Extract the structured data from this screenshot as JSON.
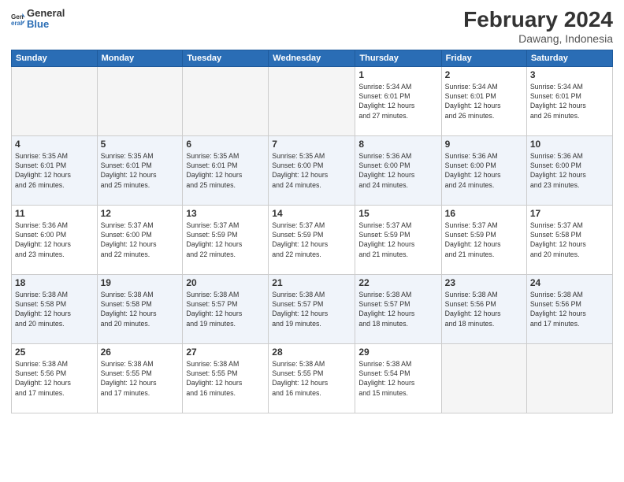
{
  "logo": {
    "line1": "General",
    "line2": "Blue"
  },
  "title": "February 2024",
  "subtitle": "Dawang, Indonesia",
  "days_header": [
    "Sunday",
    "Monday",
    "Tuesday",
    "Wednesday",
    "Thursday",
    "Friday",
    "Saturday"
  ],
  "weeks": [
    {
      "alt": false,
      "days": [
        {
          "num": "",
          "info": ""
        },
        {
          "num": "",
          "info": ""
        },
        {
          "num": "",
          "info": ""
        },
        {
          "num": "",
          "info": ""
        },
        {
          "num": "1",
          "info": "Sunrise: 5:34 AM\nSunset: 6:01 PM\nDaylight: 12 hours\nand 27 minutes."
        },
        {
          "num": "2",
          "info": "Sunrise: 5:34 AM\nSunset: 6:01 PM\nDaylight: 12 hours\nand 26 minutes."
        },
        {
          "num": "3",
          "info": "Sunrise: 5:34 AM\nSunset: 6:01 PM\nDaylight: 12 hours\nand 26 minutes."
        }
      ]
    },
    {
      "alt": true,
      "days": [
        {
          "num": "4",
          "info": "Sunrise: 5:35 AM\nSunset: 6:01 PM\nDaylight: 12 hours\nand 26 minutes."
        },
        {
          "num": "5",
          "info": "Sunrise: 5:35 AM\nSunset: 6:01 PM\nDaylight: 12 hours\nand 25 minutes."
        },
        {
          "num": "6",
          "info": "Sunrise: 5:35 AM\nSunset: 6:01 PM\nDaylight: 12 hours\nand 25 minutes."
        },
        {
          "num": "7",
          "info": "Sunrise: 5:35 AM\nSunset: 6:00 PM\nDaylight: 12 hours\nand 24 minutes."
        },
        {
          "num": "8",
          "info": "Sunrise: 5:36 AM\nSunset: 6:00 PM\nDaylight: 12 hours\nand 24 minutes."
        },
        {
          "num": "9",
          "info": "Sunrise: 5:36 AM\nSunset: 6:00 PM\nDaylight: 12 hours\nand 24 minutes."
        },
        {
          "num": "10",
          "info": "Sunrise: 5:36 AM\nSunset: 6:00 PM\nDaylight: 12 hours\nand 23 minutes."
        }
      ]
    },
    {
      "alt": false,
      "days": [
        {
          "num": "11",
          "info": "Sunrise: 5:36 AM\nSunset: 6:00 PM\nDaylight: 12 hours\nand 23 minutes."
        },
        {
          "num": "12",
          "info": "Sunrise: 5:37 AM\nSunset: 6:00 PM\nDaylight: 12 hours\nand 22 minutes."
        },
        {
          "num": "13",
          "info": "Sunrise: 5:37 AM\nSunset: 5:59 PM\nDaylight: 12 hours\nand 22 minutes."
        },
        {
          "num": "14",
          "info": "Sunrise: 5:37 AM\nSunset: 5:59 PM\nDaylight: 12 hours\nand 22 minutes."
        },
        {
          "num": "15",
          "info": "Sunrise: 5:37 AM\nSunset: 5:59 PM\nDaylight: 12 hours\nand 21 minutes."
        },
        {
          "num": "16",
          "info": "Sunrise: 5:37 AM\nSunset: 5:59 PM\nDaylight: 12 hours\nand 21 minutes."
        },
        {
          "num": "17",
          "info": "Sunrise: 5:37 AM\nSunset: 5:58 PM\nDaylight: 12 hours\nand 20 minutes."
        }
      ]
    },
    {
      "alt": true,
      "days": [
        {
          "num": "18",
          "info": "Sunrise: 5:38 AM\nSunset: 5:58 PM\nDaylight: 12 hours\nand 20 minutes."
        },
        {
          "num": "19",
          "info": "Sunrise: 5:38 AM\nSunset: 5:58 PM\nDaylight: 12 hours\nand 20 minutes."
        },
        {
          "num": "20",
          "info": "Sunrise: 5:38 AM\nSunset: 5:57 PM\nDaylight: 12 hours\nand 19 minutes."
        },
        {
          "num": "21",
          "info": "Sunrise: 5:38 AM\nSunset: 5:57 PM\nDaylight: 12 hours\nand 19 minutes."
        },
        {
          "num": "22",
          "info": "Sunrise: 5:38 AM\nSunset: 5:57 PM\nDaylight: 12 hours\nand 18 minutes."
        },
        {
          "num": "23",
          "info": "Sunrise: 5:38 AM\nSunset: 5:56 PM\nDaylight: 12 hours\nand 18 minutes."
        },
        {
          "num": "24",
          "info": "Sunrise: 5:38 AM\nSunset: 5:56 PM\nDaylight: 12 hours\nand 17 minutes."
        }
      ]
    },
    {
      "alt": false,
      "days": [
        {
          "num": "25",
          "info": "Sunrise: 5:38 AM\nSunset: 5:56 PM\nDaylight: 12 hours\nand 17 minutes."
        },
        {
          "num": "26",
          "info": "Sunrise: 5:38 AM\nSunset: 5:55 PM\nDaylight: 12 hours\nand 17 minutes."
        },
        {
          "num": "27",
          "info": "Sunrise: 5:38 AM\nSunset: 5:55 PM\nDaylight: 12 hours\nand 16 minutes."
        },
        {
          "num": "28",
          "info": "Sunrise: 5:38 AM\nSunset: 5:55 PM\nDaylight: 12 hours\nand 16 minutes."
        },
        {
          "num": "29",
          "info": "Sunrise: 5:38 AM\nSunset: 5:54 PM\nDaylight: 12 hours\nand 15 minutes."
        },
        {
          "num": "",
          "info": ""
        },
        {
          "num": "",
          "info": ""
        }
      ]
    }
  ]
}
